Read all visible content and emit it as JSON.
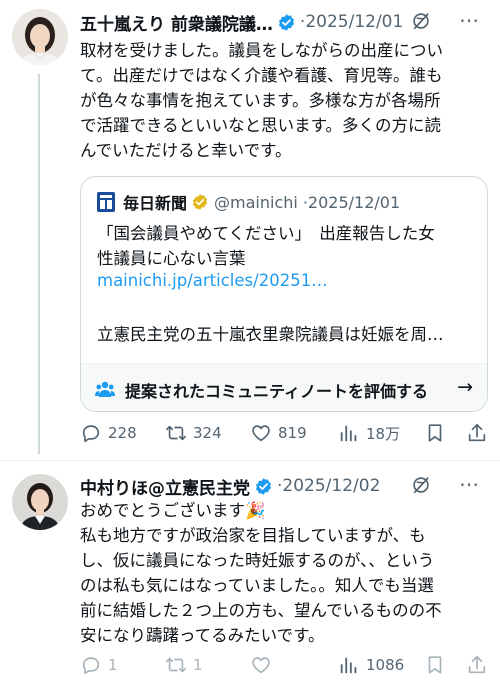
{
  "colors": {
    "accent": "#1d9bf0",
    "verified_blue": "#1d9bf0",
    "verified_gold": "#e2b719",
    "secondary_text": "#536471"
  },
  "tweet1": {
    "author_name": "五十嵐えり 前衆議院議…",
    "date": "2025/12/01",
    "lines": [
      "取材を受けました。議員をしながらの出産につい",
      "て。出産だけではなく介護や看護、育児等。誰も",
      "が色々な事情を抱えています。多様な方が各場所",
      "で活躍できるといいなと思います。多くの方に読",
      "んでいただけると幸いです。"
    ],
    "quote": {
      "source_name": "毎日新聞",
      "handle": "@mainichi",
      "date": "2025/12/01",
      "title_line1": "「国会議員やめてください」　出産報告した女",
      "title_line2": "性議員に心ない言葉",
      "link": "mainichi.jp/articles/20251…",
      "snippet": "立憲民主党の五十嵐衣里衆院議員は妊娠を周…",
      "community_note_label": "提案されたコミュニティノートを評価する",
      "community_note_arrow": "→"
    },
    "actions": {
      "replies": "228",
      "retweets": "324",
      "likes": "819",
      "views": "18万"
    }
  },
  "tweet2": {
    "author_name": "中村りほ@立憲民主党",
    "date": "2025/12/02",
    "lines": [
      "おめでとうございます🎉",
      "私も地方ですが政治家を目指していますが、も",
      "し、仮に議員になった時妊娠するのが、、という",
      "のは私も気にはなっていました。。知人でも当選",
      "前に結婚した２つ上の方も、望んでいるものの不",
      "安になり躊躇ってるみたいです。"
    ],
    "actions": {
      "replies": "1",
      "retweets": "1",
      "likes": "",
      "views": "1086"
    }
  },
  "icons": {
    "more": "more-icon",
    "grok": "grok-icon",
    "reply": "reply-icon",
    "retweet": "retweet-icon",
    "like": "heart-icon",
    "views": "views-icon",
    "bookmark": "bookmark-icon",
    "share": "share-icon",
    "community_note": "community-note-icon"
  },
  "separator": "·"
}
